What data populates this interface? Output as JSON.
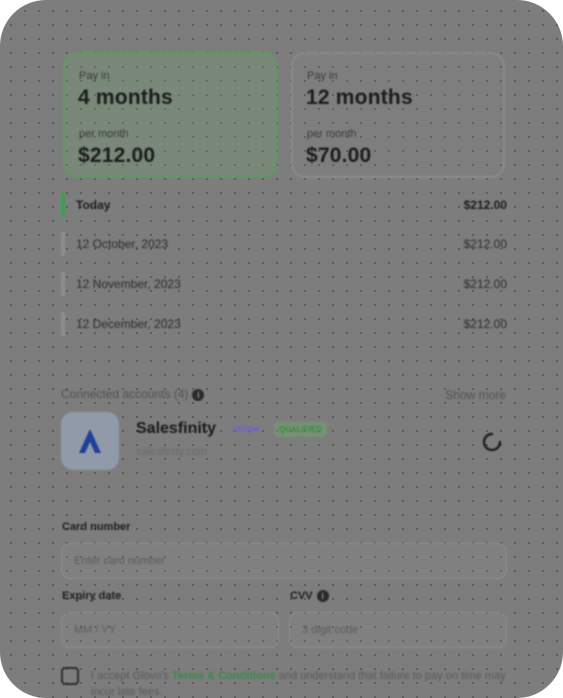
{
  "plans": [
    {
      "pay_label": "Pay in",
      "duration": "4 months",
      "per_label": "per month",
      "price": "$212.00",
      "selected": true
    },
    {
      "pay_label": "Pay in",
      "duration": "12 months",
      "per_label": "per month",
      "price": "$70.00",
      "selected": false
    }
  ],
  "schedule": [
    {
      "date": "Today",
      "amount": "$212.00",
      "active": true
    },
    {
      "date": "12 October, 2023",
      "amount": "$212.00",
      "active": false
    },
    {
      "date": "12 November, 2023",
      "amount": "$212.00",
      "active": false
    },
    {
      "date": "12 December, 2023",
      "amount": "$212.00",
      "active": false
    }
  ],
  "accounts": {
    "title": "Connected accounts (4)",
    "show_more": "Show more",
    "item": {
      "name": "Salesfinity",
      "badge_stripe": "stripe",
      "badge_status": "QUALIFIED",
      "domain": "salesfinity.com"
    }
  },
  "form": {
    "card_label": "Card number",
    "card_placeholder": "Enter card number",
    "expiry_label": "Expiry date",
    "expiry_placeholder": "MM / YY",
    "cvv_label": "CVV",
    "cvv_placeholder": "3 digit code"
  },
  "terms": {
    "prefix": "I accept Glovo's",
    "link": "Terms & Conditions",
    "suffix": "and understand that failure to pay on time may incur late fees."
  },
  "colors": {
    "accent_green": "#3aa14f",
    "stripe_purple": "#6c5fd6",
    "brand_blue": "#1f3f9a"
  }
}
